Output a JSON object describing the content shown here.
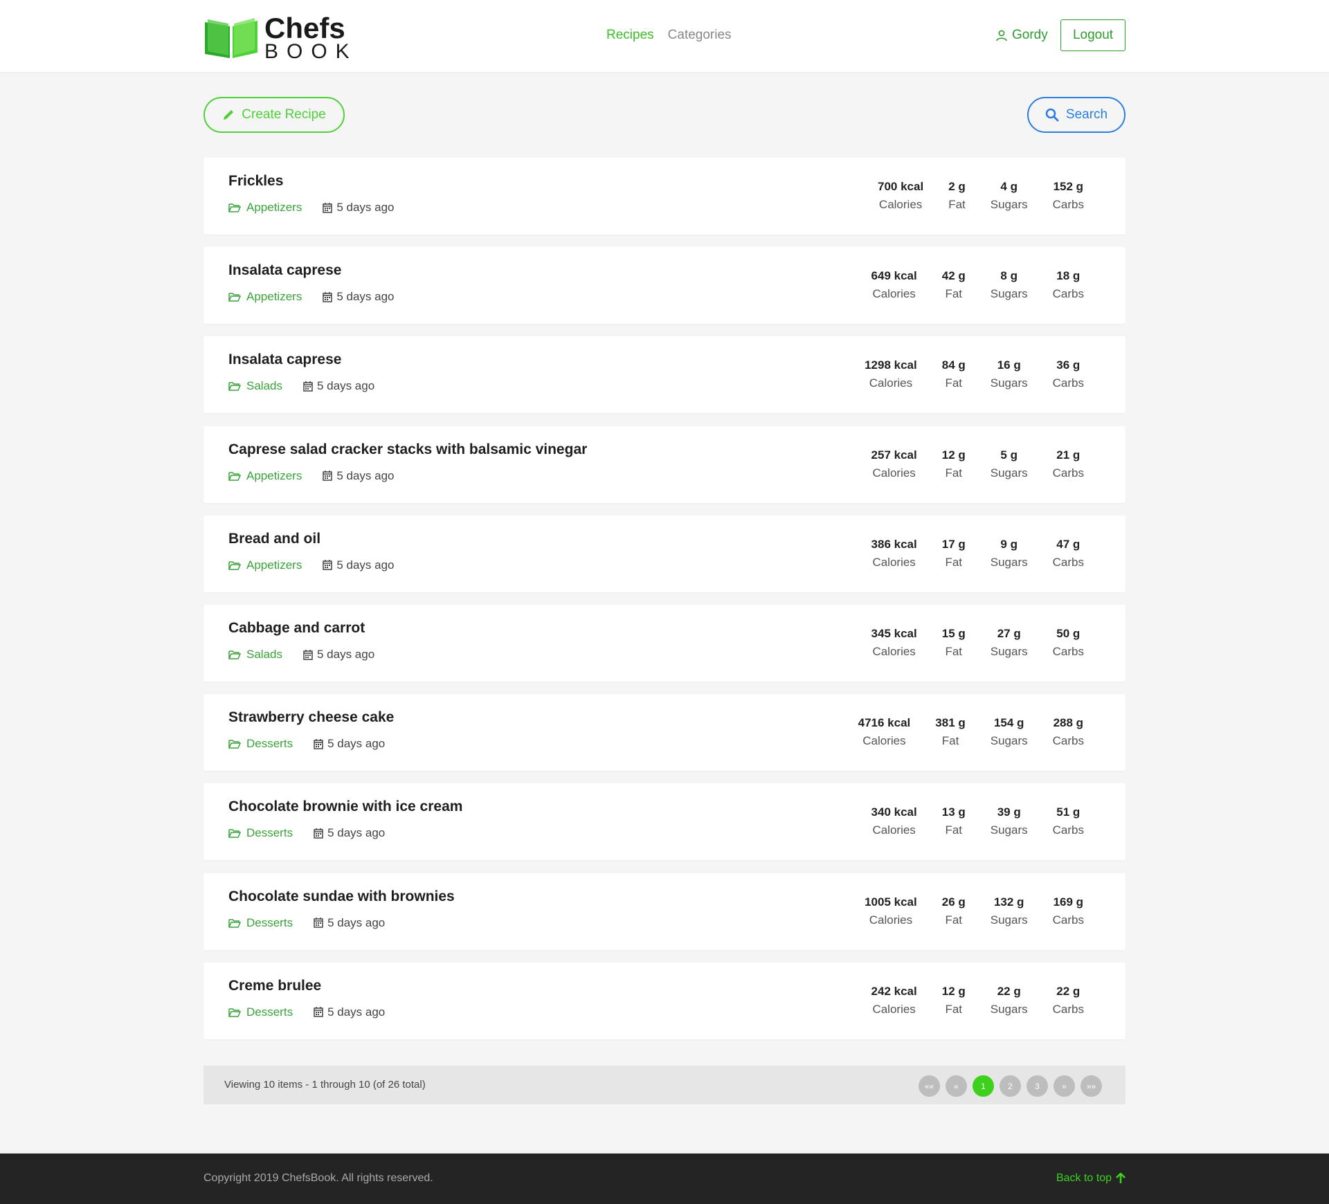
{
  "brand": {
    "line1": "Chefs",
    "line2": "BOOK"
  },
  "nav": {
    "recipes": "Recipes",
    "categories": "Categories"
  },
  "user": {
    "name": "Gordy",
    "logout": "Logout"
  },
  "actions": {
    "create": "Create Recipe",
    "search": "Search"
  },
  "recipes": [
    {
      "title": "Frickles",
      "category": "Appetizers",
      "date": "5 days ago",
      "calories": "700 kcal",
      "fat": "2 g",
      "sugars": "4 g",
      "carbs": "152 g"
    },
    {
      "title": "Insalata caprese",
      "category": "Appetizers",
      "date": "5 days ago",
      "calories": "649 kcal",
      "fat": "42 g",
      "sugars": "8 g",
      "carbs": "18 g"
    },
    {
      "title": "Insalata caprese",
      "category": "Salads",
      "date": "5 days ago",
      "calories": "1298 kcal",
      "fat": "84 g",
      "sugars": "16 g",
      "carbs": "36 g"
    },
    {
      "title": "Caprese salad cracker stacks with balsamic vinegar",
      "category": "Appetizers",
      "date": "5 days ago",
      "calories": "257 kcal",
      "fat": "12 g",
      "sugars": "5 g",
      "carbs": "21 g"
    },
    {
      "title": "Bread and oil",
      "category": "Appetizers",
      "date": "5 days ago",
      "calories": "386 kcal",
      "fat": "17 g",
      "sugars": "9 g",
      "carbs": "47 g"
    },
    {
      "title": "Cabbage and carrot",
      "category": "Salads",
      "date": "5 days ago",
      "calories": "345 kcal",
      "fat": "15 g",
      "sugars": "27 g",
      "carbs": "50 g"
    },
    {
      "title": "Strawberry cheese cake",
      "category": "Desserts",
      "date": "5 days ago",
      "calories": "4716 kcal",
      "fat": "381 g",
      "sugars": "154 g",
      "carbs": "288 g"
    },
    {
      "title": "Chocolate brownie with ice cream",
      "category": "Desserts",
      "date": "5 days ago",
      "calories": "340 kcal",
      "fat": "13 g",
      "sugars": "39 g",
      "carbs": "51 g"
    },
    {
      "title": "Chocolate sundae with brownies",
      "category": "Desserts",
      "date": "5 days ago",
      "calories": "1005 kcal",
      "fat": "26 g",
      "sugars": "132 g",
      "carbs": "169 g"
    },
    {
      "title": "Creme brulee",
      "category": "Desserts",
      "date": "5 days ago",
      "calories": "242 kcal",
      "fat": "12 g",
      "sugars": "22 g",
      "carbs": "22 g"
    }
  ],
  "stat_labels": {
    "calories": "Calories",
    "fat": "Fat",
    "sugars": "Sugars",
    "carbs": "Carbs"
  },
  "pagination": {
    "summary": "Viewing 10 items - 1 through 10 (of 26 total)",
    "buttons": [
      "««",
      "«",
      "1",
      "2",
      "3",
      "»",
      "»»"
    ],
    "active": "1"
  },
  "footer": {
    "copyright": "Copyright 2019 ChefsBook. All rights reserved.",
    "back_to_top": "Back to top"
  },
  "colors": {
    "green": "#3dbd2b",
    "blue": "#2a7de1",
    "footer_bg": "#242424"
  }
}
